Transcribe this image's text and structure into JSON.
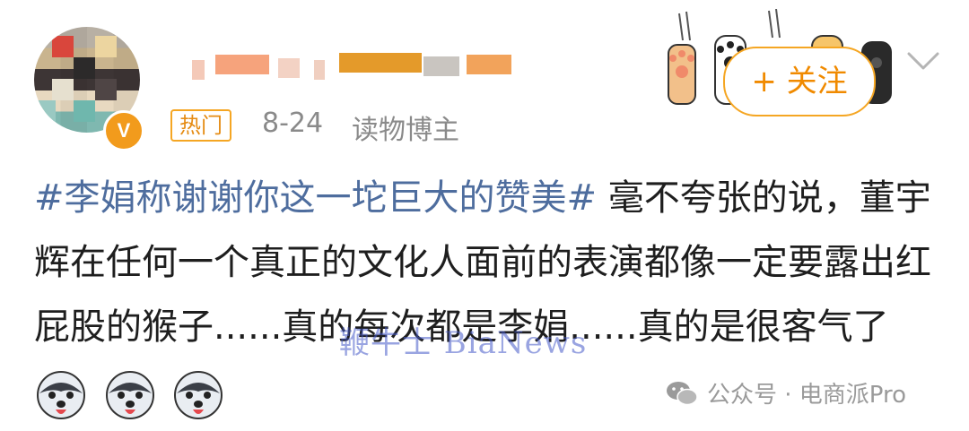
{
  "post_header": {
    "hot_tag": "热门",
    "date": "8-24",
    "role": "读物博主",
    "verified_badge": "V"
  },
  "follow_button": {
    "label": "+ 关注"
  },
  "post_body": {
    "hashtag": "#李娟称谢谢你这一坨巨大的赞美#",
    "text": " 毫不夸张的说，董宇辉在任何一个真正的文化人面前的表演都像一定要露出红屁股的猴子......真的每次都是李娟......真的是很客气了"
  },
  "watermark": "鞭牛士 BiaNews",
  "source": "公众号 · 电商派Pro",
  "icons": [
    "avatar",
    "verified-badge-icon",
    "cat-paw-icon",
    "chevron-down-icon",
    "husky-emoji-icon",
    "wechat-icon"
  ],
  "colors": {
    "accent": "#f5a623",
    "hashtag": "#4e6d9e",
    "meta": "#8a8a8a"
  }
}
